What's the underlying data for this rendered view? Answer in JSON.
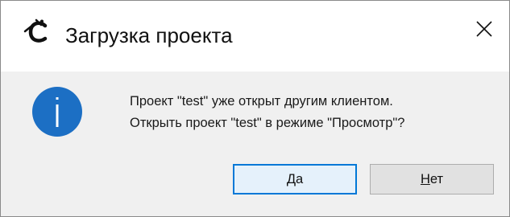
{
  "window": {
    "title": "Загрузка проекта",
    "app_icon": "app-logo-icon",
    "close_icon": "close-icon"
  },
  "message": {
    "icon": "info-icon",
    "line1": "Проект \"test\" уже открыт другим клиентом.",
    "line2": "Открыть проект \"test\" в режиме \"Просмотр\"?"
  },
  "buttons": {
    "yes": {
      "mnemonic": "Д",
      "rest": "а"
    },
    "no": {
      "mnemonic": "Н",
      "rest": "ет"
    }
  },
  "colors": {
    "info_icon": "#1c6fc4",
    "default_button_border": "#0078d7",
    "content_background": "#f0f0f0"
  }
}
